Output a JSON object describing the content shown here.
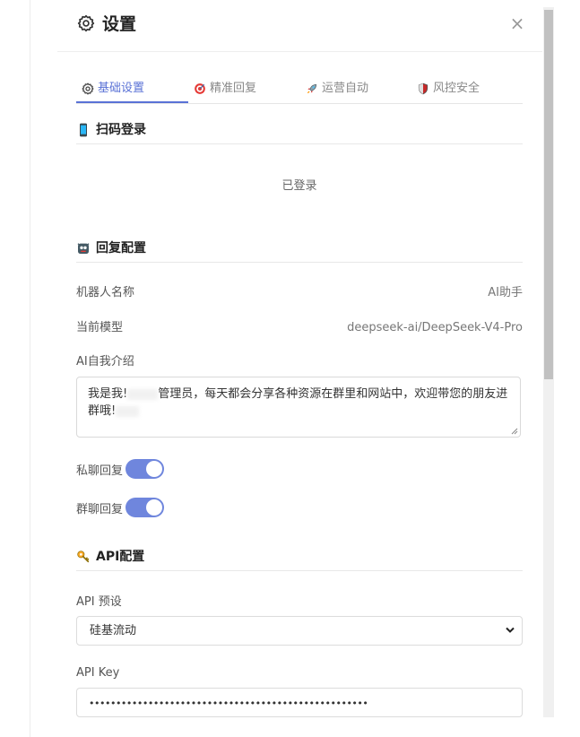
{
  "header": {
    "title": "设置",
    "close_label": "×"
  },
  "tabs": [
    {
      "label": "基础设置",
      "icon": "gear-icon"
    },
    {
      "label": "精准回复",
      "icon": "target-icon"
    },
    {
      "label": "运营自动",
      "icon": "rocket-icon"
    },
    {
      "label": "风控安全",
      "icon": "shield-icon"
    }
  ],
  "scan_login": {
    "title": "扫码登录",
    "status": "已登录"
  },
  "reply_config": {
    "title": "回复配置",
    "bot_name_label": "机器人名称",
    "bot_name_value": "AI助手",
    "model_label": "当前模型",
    "model_value": "deepseek-ai/DeepSeek-V4-Pro",
    "intro_label": "AI自我介绍",
    "intro_part1": "我是我!",
    "intro_part2": "管理员，每天都会分享各种资源在群里和网站中，欢迎带您的朋友进",
    "intro_part3": "群哦!",
    "private_label": "私聊回复",
    "group_label": "群聊回复"
  },
  "api_config": {
    "title": "API配置",
    "preset_label": "API 预设",
    "preset_value": "硅基流动",
    "key_label": "API Key",
    "key_value": "••••••••••••••••••••••••••••••••••••••••••••••••••••"
  },
  "colors": {
    "accent": "#5a72d6",
    "toggle_on": "#6f86dd"
  }
}
